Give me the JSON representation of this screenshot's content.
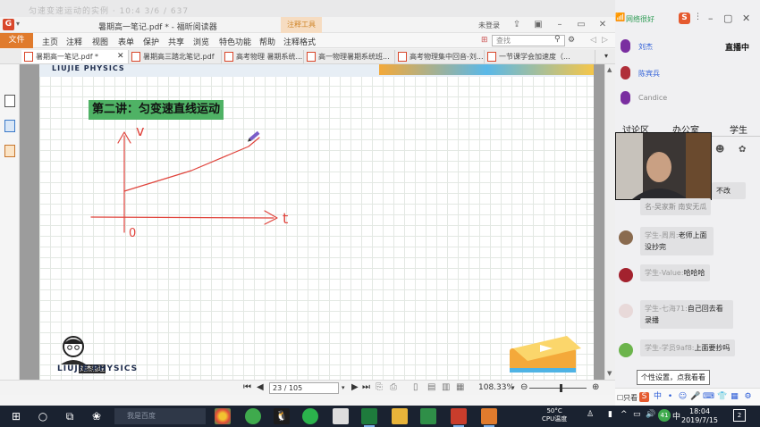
{
  "reader": {
    "outer_title": "匀速变速运动的实例 · 10:4 3/6 / 637",
    "quick_access_arrow": "▾",
    "doc_title": "暑期高一笔记.pdf * - 福昕阅读器",
    "context_tab": "注释工具",
    "login": "未登录",
    "menu": [
      "文件",
      "主页",
      "注释",
      "视图",
      "表单",
      "保护",
      "共享",
      "浏览",
      "特色功能",
      "帮助",
      "注释格式"
    ],
    "search_placeholder": "查找",
    "tabs": [
      {
        "label": "暑期高一笔记.pdf *",
        "active": true
      },
      {
        "label": "暑期高三踏北笔记.pdf",
        "active": false
      },
      {
        "label": "高考物理 暑期系统...",
        "active": false
      },
      {
        "label": "高一物理暑期系统班...",
        "active": false
      },
      {
        "label": "高考物理集中回音-刘...",
        "active": false
      },
      {
        "label": "一节课学会加速度（...",
        "active": false
      }
    ],
    "tab_close": "✕",
    "page": {
      "brand_top": "LIUJIE PHYSICS",
      "lecture_title": "第二讲：匀变速直线运动",
      "axis_v": "v",
      "axis_t": "t",
      "origin": "0",
      "logo_caption": "刘杰物理",
      "brand_bottom": "LIUJIE PHYSICS"
    },
    "status": {
      "page_display": "23 / 105",
      "zoom": "108.33%",
      "zoom_fraction": 0.55
    }
  },
  "classroom": {
    "network_status": "网络很好",
    "badge": "S",
    "mic_users": [
      {
        "name": "刘杰",
        "status": "直播中"
      },
      {
        "name": "陈宾兵",
        "status": ""
      },
      {
        "name": "Candice",
        "status": ""
      }
    ],
    "tabs": [
      "讨论区",
      "办公室",
      "学生"
    ],
    "messages": [
      {
        "sender": "",
        "text": "不改"
      },
      {
        "sender": "",
        "text": "名-吴家斯  南安无瓜"
      },
      {
        "sender": "学生-周周:",
        "text": "老师上面没抄完"
      },
      {
        "sender": "学生-Value:",
        "text": "哈哈哈"
      },
      {
        "sender": "学生-七海71:",
        "text": "自己回去看录播"
      },
      {
        "sender": "学生-学员9af8:",
        "text": "上面要抄吗"
      }
    ],
    "tooltip": "个性设置，点我看看",
    "only_see": "只看"
  },
  "taskbar": {
    "search_placeholder": "我是百度",
    "temp": "50°C",
    "temp_label": "CPU温度",
    "ime": "中",
    "time": "18:04",
    "date": "2019/7/15",
    "notify_count": "2",
    "tray_badge": "41"
  },
  "colors": {
    "accent_orange": "#e07b2d",
    "title_green": "#4fb265",
    "ink_red": "#e0443c",
    "online_green": "#2f9c55",
    "link_blue": "#2a5bd7"
  }
}
